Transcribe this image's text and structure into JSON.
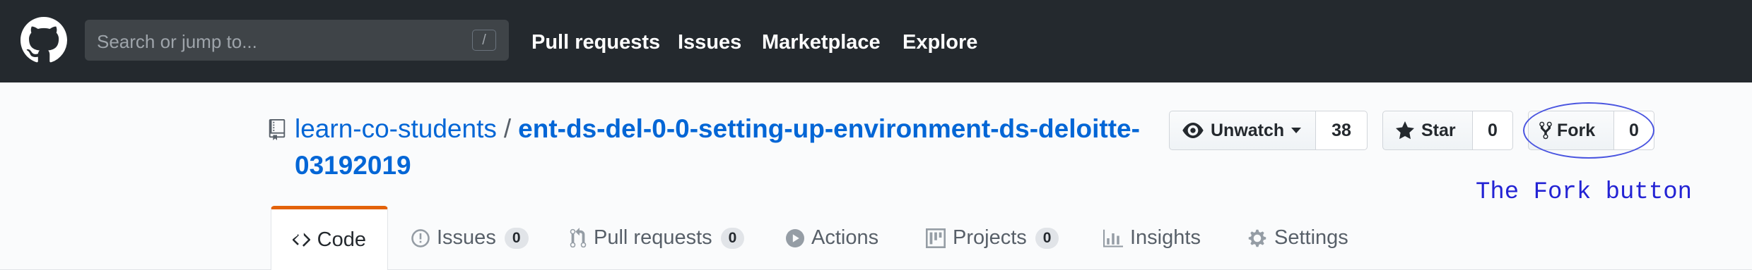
{
  "header": {
    "search_placeholder": "Search or jump to...",
    "search_shortcut": "/",
    "nav": [
      {
        "label": "Pull requests"
      },
      {
        "label": "Issues"
      },
      {
        "label": "Marketplace"
      },
      {
        "label": "Explore"
      }
    ]
  },
  "repo": {
    "owner": "learn-co-students",
    "separator": "/",
    "name": "ent-ds-del-0-0-setting-up-environment-ds-deloitte-03192019"
  },
  "actions": {
    "watch": {
      "label": "Unwatch",
      "count": "38"
    },
    "star": {
      "label": "Star",
      "count": "0"
    },
    "fork": {
      "label": "Fork",
      "count": "0"
    }
  },
  "annotation": "The Fork button",
  "tabs": [
    {
      "label": "Code",
      "icon": "code-icon",
      "selected": true
    },
    {
      "label": "Issues",
      "icon": "issue-icon",
      "badge": "0"
    },
    {
      "label": "Pull requests",
      "icon": "pull-request-icon",
      "badge": "0"
    },
    {
      "label": "Actions",
      "icon": "play-icon"
    },
    {
      "label": "Projects",
      "icon": "project-icon",
      "badge": "0"
    },
    {
      "label": "Insights",
      "icon": "graph-icon"
    },
    {
      "label": "Settings",
      "icon": "gear-icon"
    }
  ],
  "colors": {
    "header_bg": "#24292e",
    "link": "#0366d6",
    "selected_tab_accent": "#e36209",
    "annotation": "#2323d4"
  }
}
